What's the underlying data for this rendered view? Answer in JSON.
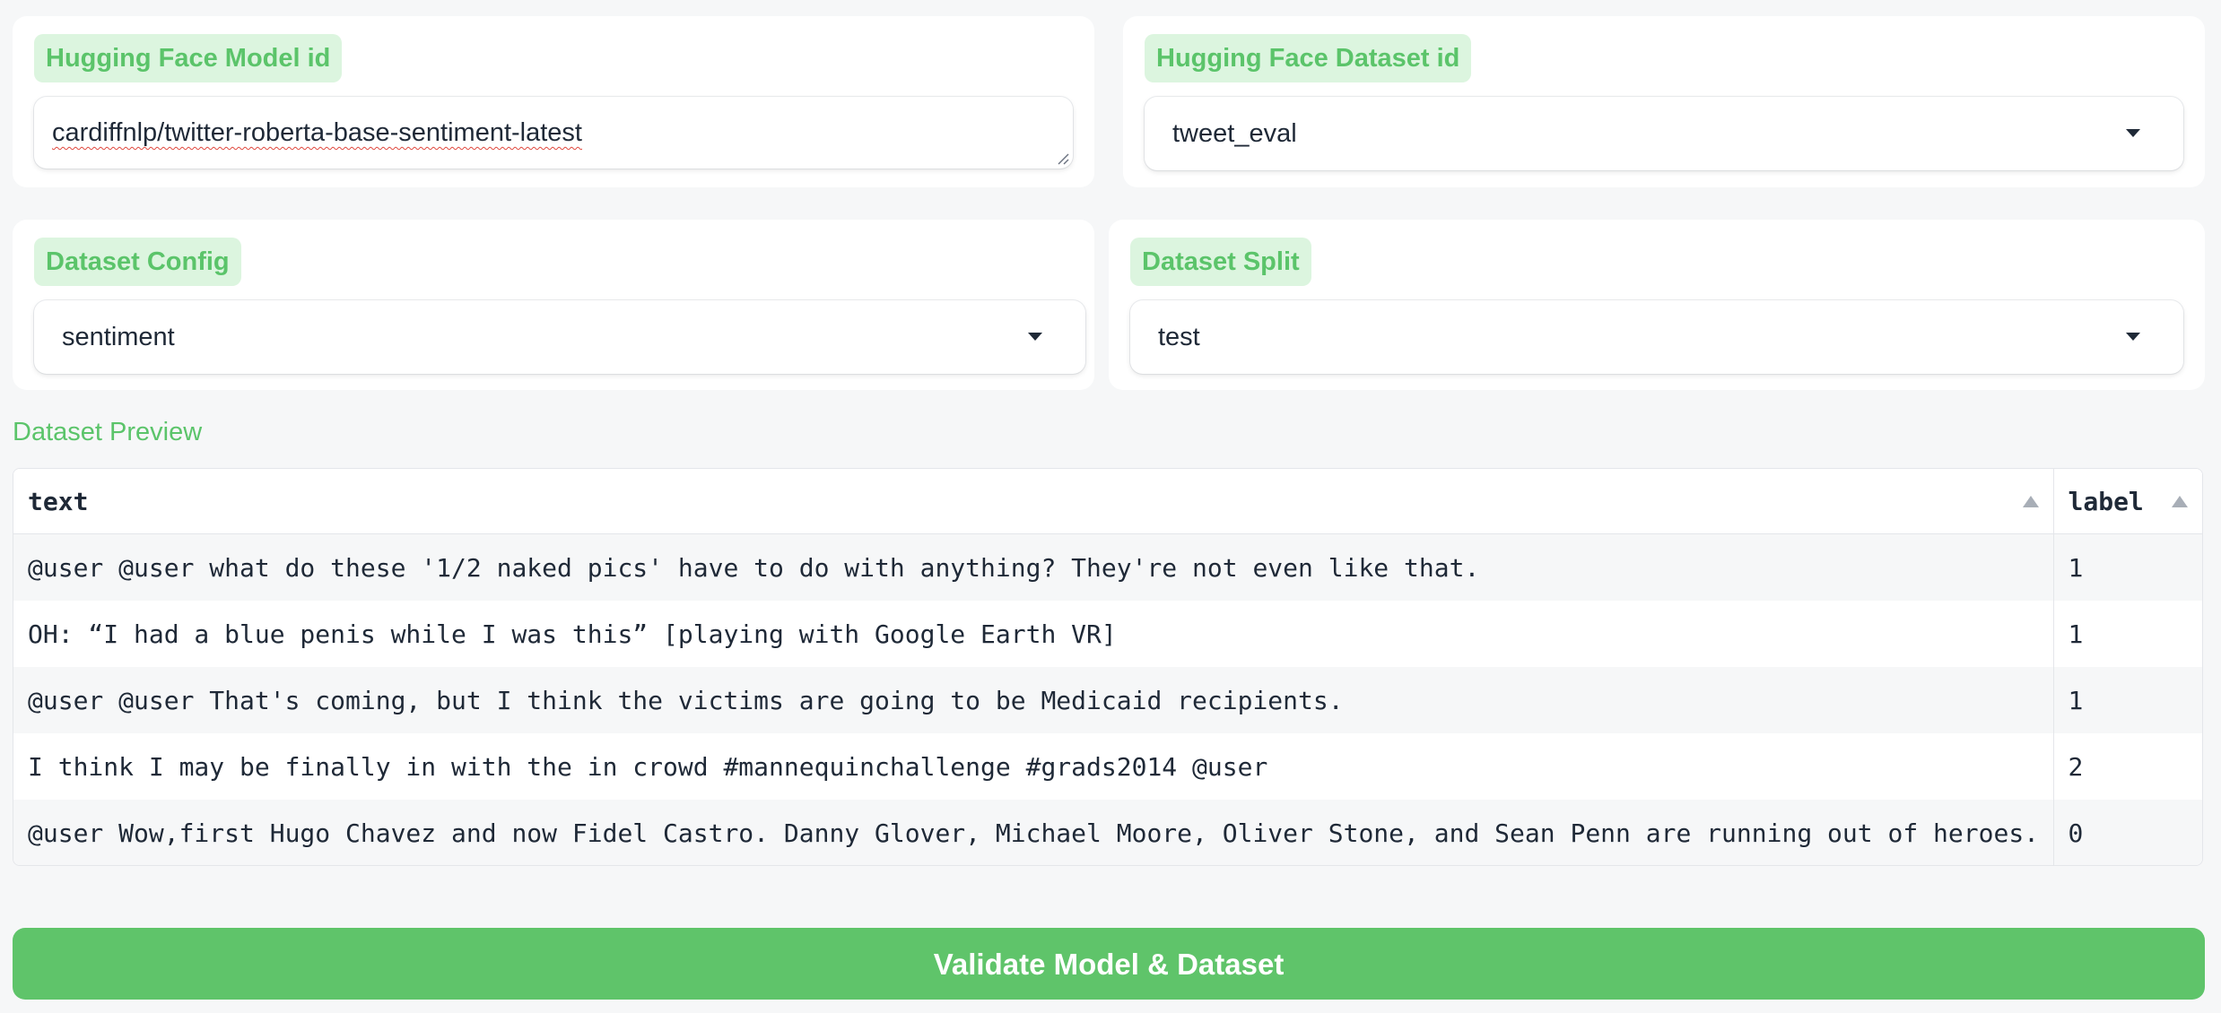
{
  "model_field": {
    "label": "Hugging Face Model id",
    "value": "cardiffnlp/twitter-roberta-base-sentiment-latest"
  },
  "dataset_field": {
    "label": "Hugging Face Dataset id",
    "value": "tweet_eval"
  },
  "config_field": {
    "label": "Dataset Config",
    "value": "sentiment"
  },
  "split_field": {
    "label": "Dataset Split",
    "value": "test"
  },
  "preview": {
    "title": "Dataset Preview",
    "columns": [
      "text",
      "label"
    ],
    "rows": [
      [
        "@user @user what do these '1/2 naked pics' have to do with anything? They're not even like that.",
        "1"
      ],
      [
        "OH: “I had a blue penis while I was this” [playing with Google Earth VR]",
        "1"
      ],
      [
        "@user @user That's coming, but I think the victims are going to be Medicaid recipients.",
        "1"
      ],
      [
        "I think I may be finally in with the in crowd #mannequinchallenge #grads2014 @user",
        "2"
      ],
      [
        "@user Wow,first Hugo Chavez and now Fidel Castro. Danny Glover, Michael Moore, Oliver Stone, and Sean Penn are running out of heroes.",
        "0"
      ]
    ]
  },
  "validate_button": {
    "label": "Validate Model & Dataset"
  },
  "icons": {
    "dropdown": "chevron-down-icon",
    "sort": "sort-ascending-icon",
    "resize": "resize-handle-icon"
  },
  "colors": {
    "accent": "#5fc46a",
    "badge_bg": "#dcf5df",
    "badge_text": "#5bc46a"
  }
}
